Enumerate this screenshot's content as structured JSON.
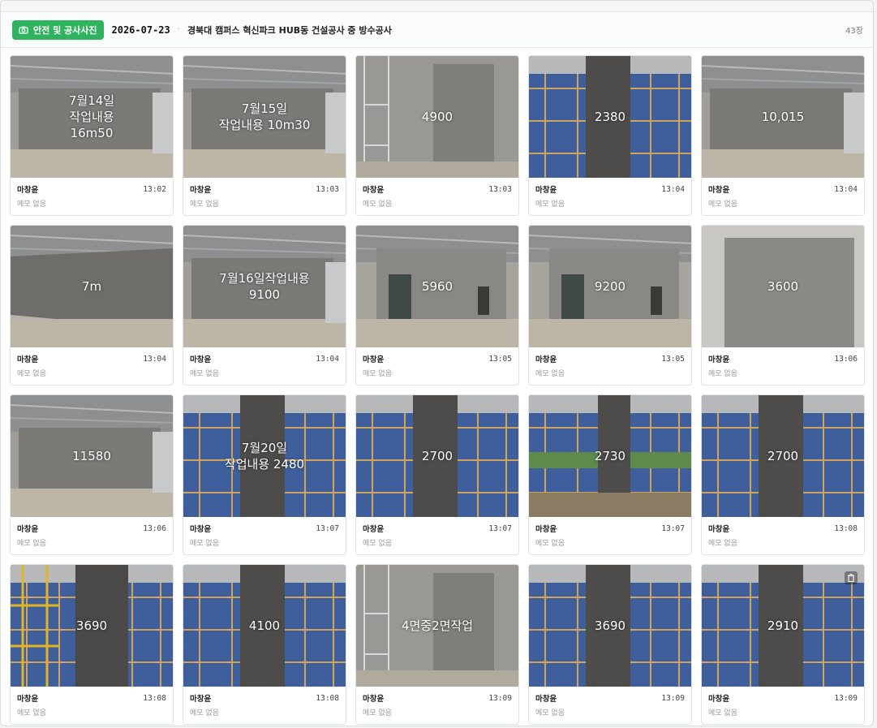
{
  "header": {
    "tag_label": "안전 및 공사사진",
    "date": "2026-07-23",
    "title": "경북대 캠퍼스 혁신파크 HUB동 건설공사 중 방수공사",
    "count": "43장"
  },
  "photos": [
    {
      "overlay": "7월14일\n작업내용\n16m50",
      "author": "마창윤",
      "time": "13:02",
      "memo": "메모 없음",
      "scene": "wall-interior"
    },
    {
      "overlay": "7월15일\n작업내용 10m30",
      "author": "마창윤",
      "time": "13:03",
      "memo": "메모 없음",
      "scene": "wall-interior"
    },
    {
      "overlay": "4900",
      "author": "마창윤",
      "time": "13:03",
      "memo": "메모 없음",
      "scene": "wall-scaffold"
    },
    {
      "overlay": "2380",
      "author": "마창윤",
      "time": "13:04",
      "memo": "메모 없음",
      "scene": "column-blue"
    },
    {
      "overlay": "10,015",
      "author": "마창윤",
      "time": "13:04",
      "memo": "메모 없음",
      "scene": "wall-interior"
    },
    {
      "overlay": "7m",
      "author": "마창윤",
      "time": "13:04",
      "memo": "메모 없음",
      "scene": "wall-long"
    },
    {
      "overlay": "7월16일작업내용\n9100",
      "author": "마창윤",
      "time": "13:04",
      "memo": "메모 없음",
      "scene": "wall-interior"
    },
    {
      "overlay": "5960",
      "author": "마창윤",
      "time": "13:05",
      "memo": "메모 없음",
      "scene": "wall-door"
    },
    {
      "overlay": "9200",
      "author": "마창윤",
      "time": "13:05",
      "memo": "메모 없음",
      "scene": "wall-door"
    },
    {
      "overlay": "3600",
      "author": "마창윤",
      "time": "13:06",
      "memo": "메모 없음",
      "scene": "wall-plain"
    },
    {
      "overlay": "11580",
      "author": "마창윤",
      "time": "13:06",
      "memo": "메모 없음",
      "scene": "wall-interior"
    },
    {
      "overlay": "7월20일\n작업내용 2480",
      "author": "마창윤",
      "time": "13:07",
      "memo": "메모 없음",
      "scene": "column-blue"
    },
    {
      "overlay": "2700",
      "author": "마창윤",
      "time": "13:07",
      "memo": "메모 없음",
      "scene": "column-blue"
    },
    {
      "overlay": "2730",
      "author": "마창윤",
      "time": "13:07",
      "memo": "메모 없음",
      "scene": "column-green"
    },
    {
      "overlay": "2700",
      "author": "마창윤",
      "time": "13:08",
      "memo": "메모 없음",
      "scene": "column-blue"
    },
    {
      "overlay": "3690",
      "author": "마창윤",
      "time": "13:08",
      "memo": "메모 없음",
      "scene": "column-yellow"
    },
    {
      "overlay": "4100",
      "author": "마창윤",
      "time": "13:08",
      "memo": "메모 없음",
      "scene": "column-blue"
    },
    {
      "overlay": "4면중2면작업",
      "author": "마창윤",
      "time": "13:09",
      "memo": "메모 없음",
      "scene": "wall-scaffold"
    },
    {
      "overlay": "3690",
      "author": "마창윤",
      "time": "13:09",
      "memo": "메모 없음",
      "scene": "column-blue"
    },
    {
      "overlay": "2910",
      "author": "마창윤",
      "time": "13:09",
      "memo": "메모 없음",
      "scene": "column-blue"
    }
  ],
  "icons": {
    "tag": "camera-icon",
    "delete": "trash-icon"
  },
  "colors": {
    "tag_bg": "#2fb35f"
  }
}
